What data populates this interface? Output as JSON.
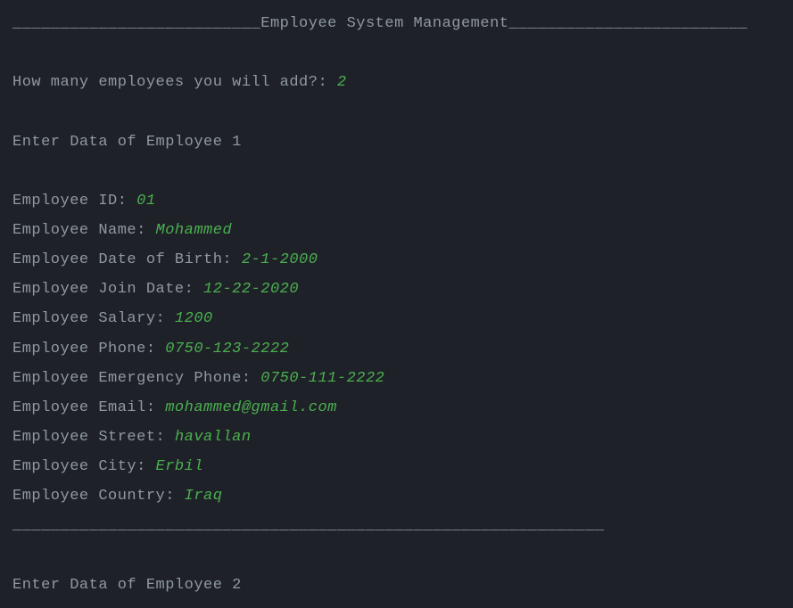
{
  "header": {
    "dashes_left": "__________________________",
    "title": "Employee System Management",
    "dashes_right": "_________________________"
  },
  "prompt": {
    "question": "How many employees you will add?: ",
    "answer": "2"
  },
  "section1": {
    "title": "Enter Data of Employee 1"
  },
  "fields": {
    "id_label": "Employee ID: ",
    "id_value": "01",
    "name_label": "Employee Name: ",
    "name_value": "Mohammed",
    "dob_label": "Employee Date of Birth: ",
    "dob_value": "2-1-2000",
    "join_label": "Employee Join Date: ",
    "join_value": "12-22-2020",
    "salary_label": "Employee Salary: ",
    "salary_value": "1200",
    "phone_label": "Employee Phone: ",
    "phone_value": "0750-123-2222",
    "emergency_label": "Employee Emergency Phone: ",
    "emergency_value": "0750-111-2222",
    "email_label": "Employee Email: ",
    "email_value": "mohammed@gmail.com",
    "street_label": "Employee Street: ",
    "street_value": "havallan",
    "city_label": "Employee City: ",
    "city_value": "Erbil",
    "country_label": "Employee Country: ",
    "country_value": "Iraq"
  },
  "divider": "______________________________________________________________",
  "section2": {
    "title": "Enter Data of Employee 2"
  }
}
